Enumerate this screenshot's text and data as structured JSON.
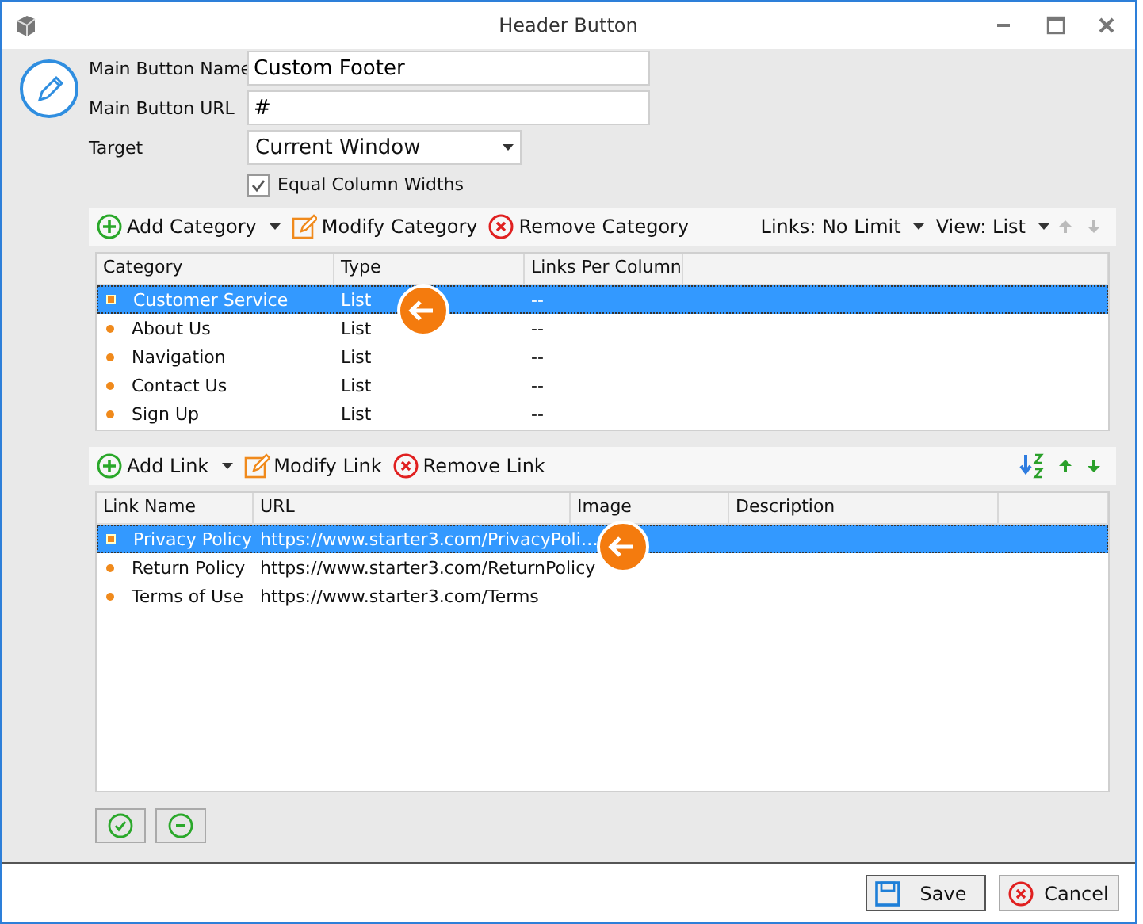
{
  "window": {
    "title": "Header Button"
  },
  "form": {
    "name_label": "Main Button Name",
    "name_value": "Custom Footer",
    "url_label": "Main Button URL",
    "url_value": "#",
    "target_label": "Target",
    "target_value": "Current Window",
    "equal_widths": {
      "label": "Equal Column Widths",
      "checked": true
    }
  },
  "category_toolbar": {
    "add": "Add Category",
    "modify": "Modify Category",
    "remove": "Remove Category",
    "links": "Links: No Limit",
    "view": "View: List"
  },
  "category_table": {
    "columns": [
      "Category",
      "Type",
      "Links Per Column"
    ],
    "rows": [
      {
        "cells": [
          "Customer Service",
          "List",
          "--"
        ],
        "selected": true
      },
      {
        "cells": [
          "About Us",
          "List",
          "--"
        ],
        "selected": false
      },
      {
        "cells": [
          "Navigation",
          "List",
          "--"
        ],
        "selected": false
      },
      {
        "cells": [
          "Contact Us",
          "List",
          "--"
        ],
        "selected": false
      },
      {
        "cells": [
          "Sign Up",
          "List",
          "--"
        ],
        "selected": false
      }
    ]
  },
  "link_toolbar": {
    "add": "Add Link",
    "modify": "Modify Link",
    "remove": "Remove Link"
  },
  "link_table": {
    "columns": [
      "Link Name",
      "URL",
      "Image",
      "Description"
    ],
    "rows": [
      {
        "cells": [
          "Privacy Policy",
          "https://www.starter3.com/PrivacyPoli…",
          "",
          ""
        ],
        "selected": true
      },
      {
        "cells": [
          "Return Policy",
          "https://www.starter3.com/ReturnPolicy",
          "",
          ""
        ],
        "selected": false
      },
      {
        "cells": [
          "Terms of Use",
          "https://www.starter3.com/Terms",
          "",
          ""
        ],
        "selected": false
      }
    ]
  },
  "footer": {
    "save": "Save",
    "cancel": "Cancel"
  }
}
